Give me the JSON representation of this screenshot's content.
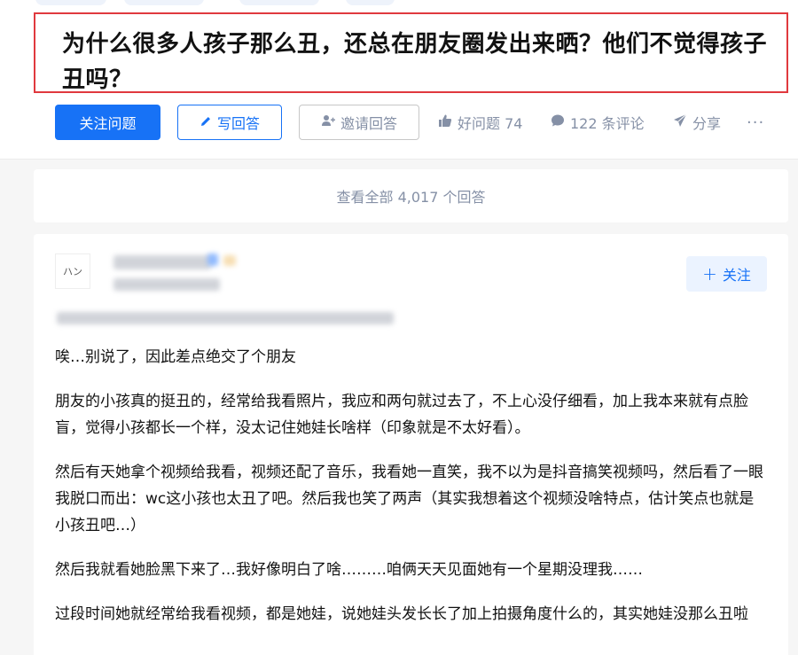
{
  "question": {
    "title": "为什么很多人孩子那么丑，还总在朋友圈发出来晒？他们不觉得孩子丑吗？"
  },
  "actions": {
    "follow_question": "关注问题",
    "write_answer": "写回答",
    "invite_answer": "邀请回答",
    "good_question": "好问题 74",
    "comments": "122 条评论",
    "share": "分享",
    "more": "···"
  },
  "view_all": "查看全部 4,017 个回答",
  "answer": {
    "avatar_text": "ハン",
    "follow_label": "关注",
    "paragraphs": [
      "唉…别说了，因此差点绝交了个朋友",
      "朋友的小孩真的挺丑的，经常给我看照片，我应和两句就过去了，不上心没仔细看，加上我本来就有点脸盲，觉得小孩都长一个样，没太记住她娃长啥样（印象就是不太好看）。",
      "然后有天她拿个视频给我看，视频还配了音乐，我看她一直笑，我不以为是抖音搞笑视频吗，然后看了一眼我脱口而出：wc这小孩也太丑了吧。然后我也笑了两声（其实我想着这个视频没啥特点，估计笑点也就是小孩丑吧…）",
      "然后我就看她脸黑下来了…我好像明白了啥………咱俩天天见面她有一个星期没理我……",
      "过段时间她就经常给我看视频，都是她娃，说她娃头发长长了加上拍摄角度什么的，其实她娃没那么丑啦"
    ]
  },
  "colors": {
    "primary": "#1772f6",
    "highlight_border": "#e0393e",
    "muted": "#8590a6"
  },
  "icons": {
    "write": "pencil-icon",
    "invite": "add-user-icon",
    "good": "thumbs-up-icon",
    "comment": "comment-bubble-icon",
    "share": "paper-plane-icon",
    "follow": "plus-icon"
  }
}
